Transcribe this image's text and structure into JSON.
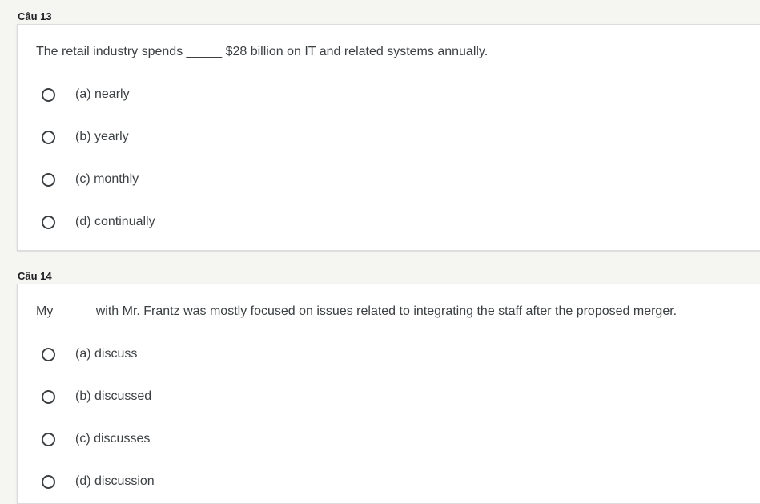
{
  "questions": [
    {
      "label": "Câu 13",
      "text": "The retail industry spends _____ $28 billion on IT and related systems annually.",
      "options": [
        "(a) nearly",
        "(b) yearly",
        "(c) monthly",
        "(d) continually"
      ]
    },
    {
      "label": "Câu 14",
      "text": "My _____ with Mr. Frantz was mostly focused on issues related to integrating the staff after the proposed merger.",
      "options": [
        "(a) discuss",
        "(b) discussed",
        "(c) discusses",
        "(d) discussion"
      ]
    }
  ]
}
